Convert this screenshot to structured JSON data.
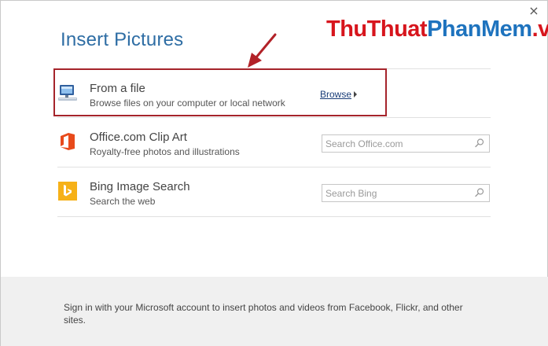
{
  "watermark": {
    "part1": "ThuThuat",
    "part2": "PhanMem",
    "part3": ".vn"
  },
  "dialog": {
    "title": "Insert Pictures",
    "close_glyph": "×"
  },
  "rows": [
    {
      "title": "From a file",
      "subtitle": "Browse files on your computer or local network",
      "action_label": "Browse",
      "icon": "computer-icon"
    },
    {
      "title": "Office.com Clip Art",
      "subtitle": "Royalty-free photos and illustrations",
      "search_placeholder": "Search Office.com",
      "icon": "office-icon"
    },
    {
      "title": "Bing Image Search",
      "subtitle": "Search the web",
      "search_placeholder": "Search Bing",
      "icon": "bing-icon"
    }
  ],
  "footer": {
    "text": "Sign in with your Microsoft account to insert photos and videos from Facebook, Flickr, and other sites."
  },
  "colors": {
    "title": "#2e6da4",
    "highlight": "#a5242b",
    "arrow": "#b22228",
    "office": "#e84a1b",
    "bing": "#f6b118",
    "footer_bg": "#f0f0f0"
  }
}
